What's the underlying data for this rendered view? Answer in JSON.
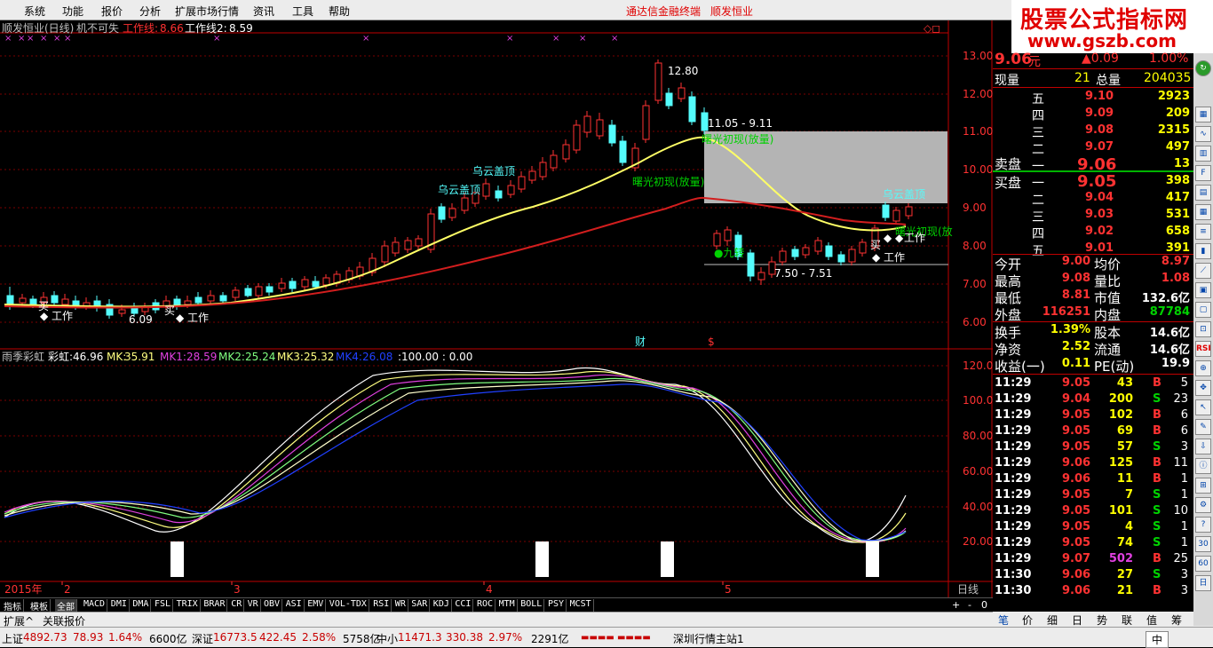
{
  "menu": {
    "items": [
      "系统",
      "功能",
      "报价",
      "分析",
      "扩展市场行情",
      "资讯",
      "工具",
      "帮助"
    ],
    "title_left": "通达信金融终端",
    "title_right": "顺发恒业"
  },
  "brand": {
    "line1": "股票公式指标网",
    "line2": "www.gszb.com"
  },
  "chart_header": {
    "stock": "顺发恒业(日线)",
    "indicator": "机不可失",
    "wl1_label": "工作线:",
    "wl1_value": "8.66",
    "wl2_label": "工作线2:",
    "wl2_value": "8.59"
  },
  "price_axis": [
    "13.00",
    "12.00",
    "11.00",
    "10.00",
    "9.00",
    "8.00",
    "7.00",
    "6.00"
  ],
  "price_annotations": {
    "high": "12.80",
    "low_left": "6.09",
    "range1": "11.05 - 9.11",
    "range2": "7.50 - 7.51",
    "wuyun1": "乌云盖顶",
    "wuyun2": "乌云盖顶",
    "wuyun3": "乌云盖顶",
    "shuguang1": "曙光初现(放量)",
    "shuguang2": "曙光初现(放量)",
    "shuguang3": "曙光初现(放",
    "jiuzhuan": "●九转",
    "gongzuo": "工作",
    "mai": "买",
    "cai": "财",
    "s_mark": "$"
  },
  "sub_header": {
    "name": "雨季彩虹",
    "caihong_label": "彩虹:",
    "caihong_value": "46.96",
    "mk_label": "MK:",
    "mk_value": "35.91",
    "mk1_label": "MK1:",
    "mk1_value": "28.59",
    "mk2_label": "MK2:",
    "mk2_value": "25.24",
    "mk3_label": "MK3:",
    "mk3_value": "25.32",
    "mk4_label": "MK4:",
    "mk4_value": "26.08",
    "tail": ":100.00 : 0.00"
  },
  "sub_axis": [
    "120.00",
    "100.00",
    "80.00",
    "60.00",
    "40.00",
    "20.00"
  ],
  "date_axis": {
    "year": "2015年",
    "months": [
      "2",
      "3",
      "4",
      "5"
    ],
    "period": "日线"
  },
  "colors": {
    "up": "#54fcfc",
    "down": "#ff3232",
    "ma_short": "#ffff66",
    "ma_long": "#d21e1e",
    "mk1": "#e040e0",
    "mk2": "#80ff80",
    "mk3": "#ffff80",
    "mk4": "#2040ff",
    "caihong": "#ffffff"
  },
  "chart_data": {
    "type": "candlestick",
    "price_axis_range": [
      6.0,
      13.0
    ],
    "annotated_high": 12.8,
    "annotated_low": 6.09,
    "work_line_1": 8.66,
    "work_line_2": 8.59,
    "indicator_axis_range": [
      20,
      120
    ],
    "indicator_last": {
      "彩虹": 46.96,
      "MK": 35.91,
      "MK1": 28.59,
      "MK2": 25.24,
      "MK3": 25.32,
      "MK4": 26.08
    }
  },
  "tabs": [
    "指标",
    "模板",
    "全部",
    "MACD",
    "DMI",
    "DMA",
    "FSL",
    "TRIX",
    "BRAR",
    "CR",
    "VR",
    "OBV",
    "ASI",
    "EMV",
    "VOL-TDX",
    "RSI",
    "WR",
    "SAR",
    "KDJ",
    "CCI",
    "ROC",
    "MTM",
    "BOLL",
    "PSY",
    "MCST"
  ],
  "tab_controls": [
    "+",
    "-",
    "0"
  ],
  "ext": [
    "扩展^",
    "关联报价"
  ],
  "quote": {
    "price": "9.06",
    "price_unit": "元",
    "change": "▲0.09",
    "change_pct": "1.00%",
    "now_vol_label": "现量",
    "now_vol": "21",
    "total_vol_label": "总量",
    "total_vol": "204035",
    "sell_label": "卖盘",
    "buy_label": "买盘",
    "asks": [
      {
        "lvl": "五",
        "price": "9.10",
        "vol": "2923"
      },
      {
        "lvl": "四",
        "price": "9.09",
        "vol": "209"
      },
      {
        "lvl": "三",
        "price": "9.08",
        "vol": "2315"
      },
      {
        "lvl": "二",
        "price": "9.07",
        "vol": "497"
      },
      {
        "lvl": "一",
        "price": "9.06",
        "vol": "13"
      }
    ],
    "bids": [
      {
        "lvl": "一",
        "price": "9.05",
        "vol": "398"
      },
      {
        "lvl": "二",
        "price": "9.04",
        "vol": "417"
      },
      {
        "lvl": "三",
        "price": "9.03",
        "vol": "531"
      },
      {
        "lvl": "四",
        "price": "9.02",
        "vol": "658"
      },
      {
        "lvl": "五",
        "price": "9.01",
        "vol": "391"
      }
    ],
    "stats": [
      {
        "l1": "今开",
        "v1": "9.00",
        "l2": "均价",
        "v2": "8.97"
      },
      {
        "l1": "最高",
        "v1": "9.08",
        "l2": "量比",
        "v2": "1.08"
      },
      {
        "l1": "最低",
        "v1": "8.81",
        "l2": "市值",
        "v2": "132.6亿"
      },
      {
        "l1": "外盘",
        "v1": "116251",
        "l2": "内盘",
        "v2": "87784"
      }
    ],
    "stats2": [
      {
        "l1": "换手",
        "v1": "1.39%",
        "l2": "股本",
        "v2": "14.6亿"
      },
      {
        "l1": "净资",
        "v1": "2.52",
        "l2": "流通",
        "v2": "14.6亿"
      },
      {
        "l1": "收益(一)",
        "v1": "0.11",
        "l2": "PE(动)",
        "v2": "19.9"
      }
    ],
    "ticks": [
      {
        "t": "11:29",
        "p": "9.05",
        "v": "43",
        "bs": "B",
        "n": "5"
      },
      {
        "t": "11:29",
        "p": "9.04",
        "v": "200",
        "bs": "S",
        "n": "23"
      },
      {
        "t": "11:29",
        "p": "9.05",
        "v": "102",
        "bs": "B",
        "n": "6"
      },
      {
        "t": "11:29",
        "p": "9.05",
        "v": "69",
        "bs": "B",
        "n": "6"
      },
      {
        "t": "11:29",
        "p": "9.05",
        "v": "57",
        "bs": "S",
        "n": "3"
      },
      {
        "t": "11:29",
        "p": "9.06",
        "v": "125",
        "bs": "B",
        "n": "11"
      },
      {
        "t": "11:29",
        "p": "9.06",
        "v": "11",
        "bs": "B",
        "n": "1"
      },
      {
        "t": "11:29",
        "p": "9.05",
        "v": "7",
        "bs": "S",
        "n": "1"
      },
      {
        "t": "11:29",
        "p": "9.05",
        "v": "101",
        "bs": "S",
        "n": "10"
      },
      {
        "t": "11:29",
        "p": "9.05",
        "v": "4",
        "bs": "S",
        "n": "1"
      },
      {
        "t": "11:29",
        "p": "9.05",
        "v": "74",
        "bs": "S",
        "n": "1"
      },
      {
        "t": "11:29",
        "p": "9.07",
        "v": "502",
        "bs": "B",
        "n": "25"
      },
      {
        "t": "11:30",
        "p": "9.06",
        "v": "27",
        "bs": "S",
        "n": "3"
      },
      {
        "t": "11:30",
        "p": "9.06",
        "v": "21",
        "bs": "B",
        "n": "3"
      }
    ]
  },
  "quote_tabs": [
    "笔",
    "价",
    "细",
    "日",
    "势",
    "联",
    "值",
    "筹"
  ],
  "rightbar": [
    "RSI"
  ],
  "status": {
    "sh_label": "上证",
    "sh_value": "4892.73",
    "sh_change": "78.93",
    "sh_pct": "1.64%",
    "sh_amount": "6600亿",
    "sz_label": "深证",
    "sz_value": "16773.5",
    "sz_change": "422.45",
    "sz_pct": "2.58%",
    "sz_amount": "5758亿",
    "zx_label": "中小",
    "zx_value": "11471.3",
    "zx_change": "330.38",
    "zx_pct": "2.97%",
    "zx_amount": "2291亿",
    "station": "深圳行情主站1",
    "ime": "中"
  }
}
